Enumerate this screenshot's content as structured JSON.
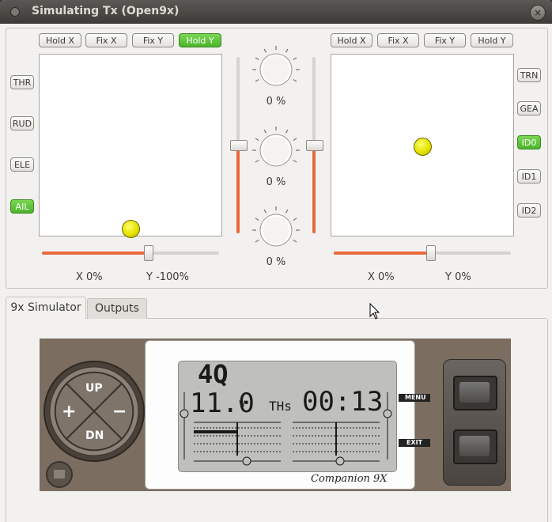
{
  "window": {
    "title": "Simulating Tx (Open9x)"
  },
  "left_stick": {
    "buttons": [
      "Hold X",
      "Fix X",
      "Fix Y",
      "Hold Y"
    ],
    "active_index": 3,
    "x_label": "X  0%",
    "y_label": "Y -100%",
    "x_value": 0,
    "y_value": -100
  },
  "right_stick": {
    "buttons": [
      "Hold X",
      "Fix X",
      "Fix Y",
      "Hold Y"
    ],
    "x_label": "X  0%",
    "y_label": "Y  0%",
    "x_value": 0,
    "y_value": 0
  },
  "left_switches": [
    "THR",
    "RUD",
    "ELE",
    "AIL"
  ],
  "left_switch_active": 3,
  "right_switches": [
    "TRN",
    "GEA",
    "ID0",
    "ID1",
    "ID2"
  ],
  "right_switch_active": 2,
  "pots": [
    "0 %",
    "0 %",
    "0 %"
  ],
  "tabs": [
    "9x Simulator",
    "Outputs"
  ],
  "active_tab": 0,
  "simulator": {
    "model": "4Q",
    "voltage": "11.0",
    "voltage_unit": "V",
    "timer_mode": "THs",
    "timer": "00:13",
    "brand": "Companion 9X",
    "keys": {
      "up": "UP",
      "down": "DN",
      "plus": "+",
      "minus": "−",
      "menu": "MENU",
      "exit": "EXIT"
    }
  },
  "colors": {
    "accent": "#e9683a",
    "active_green": "#4bb42a",
    "ball": "#e6e200"
  }
}
